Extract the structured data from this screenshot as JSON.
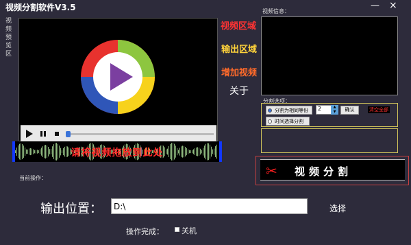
{
  "window": {
    "title": "视频分割软件V3.5",
    "minimize": "—",
    "close": "×"
  },
  "preview": {
    "label": "视频预览区",
    "overlay_text": "请将视频拖放到此处"
  },
  "player": {
    "play_icon": "play-icon",
    "pause_icon": "pause-icon",
    "stop_icon": "stop-icon",
    "progress": 0.0
  },
  "side_links": {
    "video_area": "视频区域",
    "output_area": "输出区域",
    "add_video": "增加视频",
    "about": "关于"
  },
  "video_info": {
    "label": "视频信息："
  },
  "split_options": {
    "label": "分割选项：",
    "radio_equal": "分割为相同等份",
    "radio_time": "时间选择分割",
    "parts_value": "2",
    "confirm": "确认",
    "clear_all": "清空全部"
  },
  "split_button": {
    "label": "视频分割"
  },
  "status": {
    "current_op_label": "当前操作："
  },
  "output": {
    "location_label": "输出位置：",
    "path_value": "D:\\",
    "browse": "选择"
  },
  "finish": {
    "op_done_label": "操作完成：",
    "shutdown_label": "关机",
    "shutdown_checked": false
  },
  "colors": {
    "background": "#2d2b3b",
    "video_area": "#ff3333",
    "output_area": "#ffd23a",
    "add_video": "#ff6a2a",
    "frame_gold": "#cfc25a",
    "frame_red": "#c84040",
    "spectrum_border": "#1238ff"
  }
}
